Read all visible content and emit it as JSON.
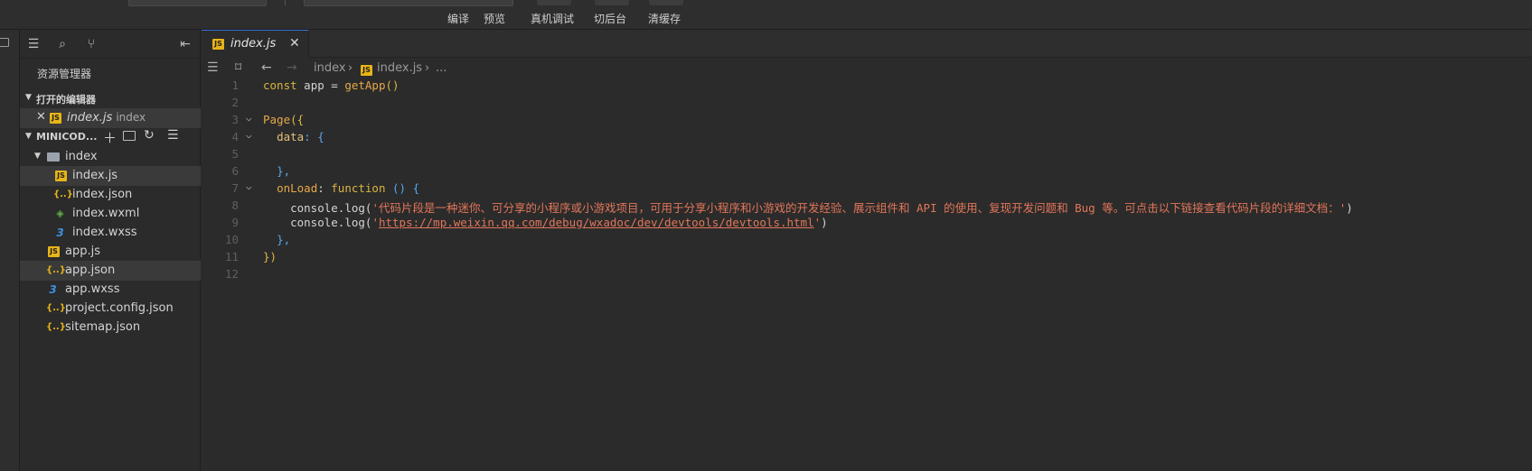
{
  "toolbar": {
    "buttons": [
      {
        "label": "编译"
      },
      {
        "label": "预览"
      },
      {
        "label": "真机调试"
      },
      {
        "label": "切后台"
      },
      {
        "label": "清缓存"
      }
    ]
  },
  "sidebar": {
    "title": "资源管理器",
    "open_editors": {
      "section_label": "打开的编辑器",
      "items": [
        {
          "name": "index.js",
          "folder": "index"
        }
      ]
    },
    "project": {
      "section_label": "MINICOD...",
      "tree": [
        {
          "name": "index",
          "type": "folder"
        },
        {
          "name": "index.js",
          "type": "js"
        },
        {
          "name": "index.json",
          "type": "json"
        },
        {
          "name": "index.wxml",
          "type": "wxml"
        },
        {
          "name": "index.wxss",
          "type": "wxss"
        },
        {
          "name": "app.js",
          "type": "js"
        },
        {
          "name": "app.json",
          "type": "json"
        },
        {
          "name": "app.wxss",
          "type": "wxss"
        },
        {
          "name": "project.config.json",
          "type": "json"
        },
        {
          "name": "sitemap.json",
          "type": "json"
        }
      ]
    }
  },
  "editor": {
    "tab": {
      "label": "index.js"
    },
    "breadcrumb": {
      "folder": "index",
      "file": "index.js",
      "more": "..."
    },
    "code": {
      "line_numbers": [
        "1",
        "2",
        "3",
        "4",
        "5",
        "6",
        "7",
        "8",
        "9",
        "10",
        "11",
        "12"
      ],
      "l1_kw": "const",
      "l1_var": " app = ",
      "l1_fn": "getApp",
      "l1_paren": "()",
      "l3_fn": "Page",
      "l3_open": "({",
      "l4_prop": "data",
      "l4_rest": ": {",
      "l6": "},",
      "l7_prop": "onLoad",
      "l7_colon": ": ",
      "l7_kw": "function",
      "l7_rest": " () {",
      "l8_obj": "console",
      "l8_method": ".log(",
      "l8_str": "'代码片段是一种迷你、可分享的小程序或小游戏项目，可用于分享小程序和小游戏的开发经验、展示组件和 API 的使用、复现开发问题和 Bug 等。可点击以下链接查看代码片段的详细文档：'",
      "l8_close": ")",
      "l9_obj": "console",
      "l9_method": ".log(",
      "l9_q1": "'",
      "l9_url": "https://mp.weixin.qq.com/debug/wxadoc/dev/devtools/devtools.html",
      "l9_q2": "'",
      "l9_close": ")",
      "l10": "},",
      "l11": "})"
    }
  }
}
